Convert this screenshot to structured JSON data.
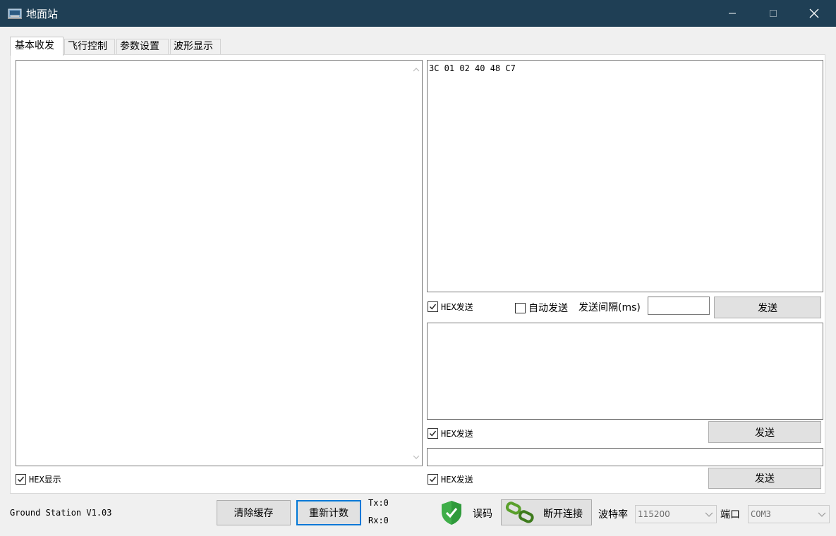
{
  "window": {
    "title": "地面站",
    "controls": {
      "minimize": "—",
      "maximize": "☐",
      "close": "✕"
    }
  },
  "tabs": [
    {
      "label": "基本收发",
      "active": true
    },
    {
      "label": "飞行控制",
      "active": false
    },
    {
      "label": "参数设置",
      "active": false
    },
    {
      "label": "波形显示",
      "active": false
    }
  ],
  "receive": {
    "content": "",
    "hex_display": {
      "label": "HEX显示",
      "checked": true
    }
  },
  "send1": {
    "content": "3C 01 02 40 48 C7",
    "hex_send": {
      "label": "HEX发送",
      "checked": true
    },
    "auto_send": {
      "label": "自动发送",
      "checked": false
    },
    "interval_label": "发送间隔(ms)",
    "interval_value": "",
    "send_label": "发送"
  },
  "send2": {
    "content": "",
    "hex_send": {
      "label": "HEX发送",
      "checked": true
    },
    "send_label": "发送"
  },
  "send3": {
    "content": "",
    "hex_send": {
      "label": "HEX发送",
      "checked": true
    },
    "send_label": "发送"
  },
  "status": {
    "version": "Ground Station V1.03",
    "clear_label": "清除缓存",
    "reset_label": "重新计数",
    "tx": "Tx:0",
    "rx": "Rx:0",
    "error_label": "误码",
    "disconnect_label": "断开连接",
    "baud_label": "波特率",
    "baud_value": "115200",
    "port_label": "端口",
    "port_value": "COM3"
  },
  "colors": {
    "titlebar": "#1f3f55",
    "shield": "#3fae49",
    "focus": "#0078d7",
    "link_icon": "#5aa02c"
  },
  "icons": {
    "app": "ground-station-icon",
    "status": "shield-check-icon",
    "connection": "chain-link-icon"
  }
}
